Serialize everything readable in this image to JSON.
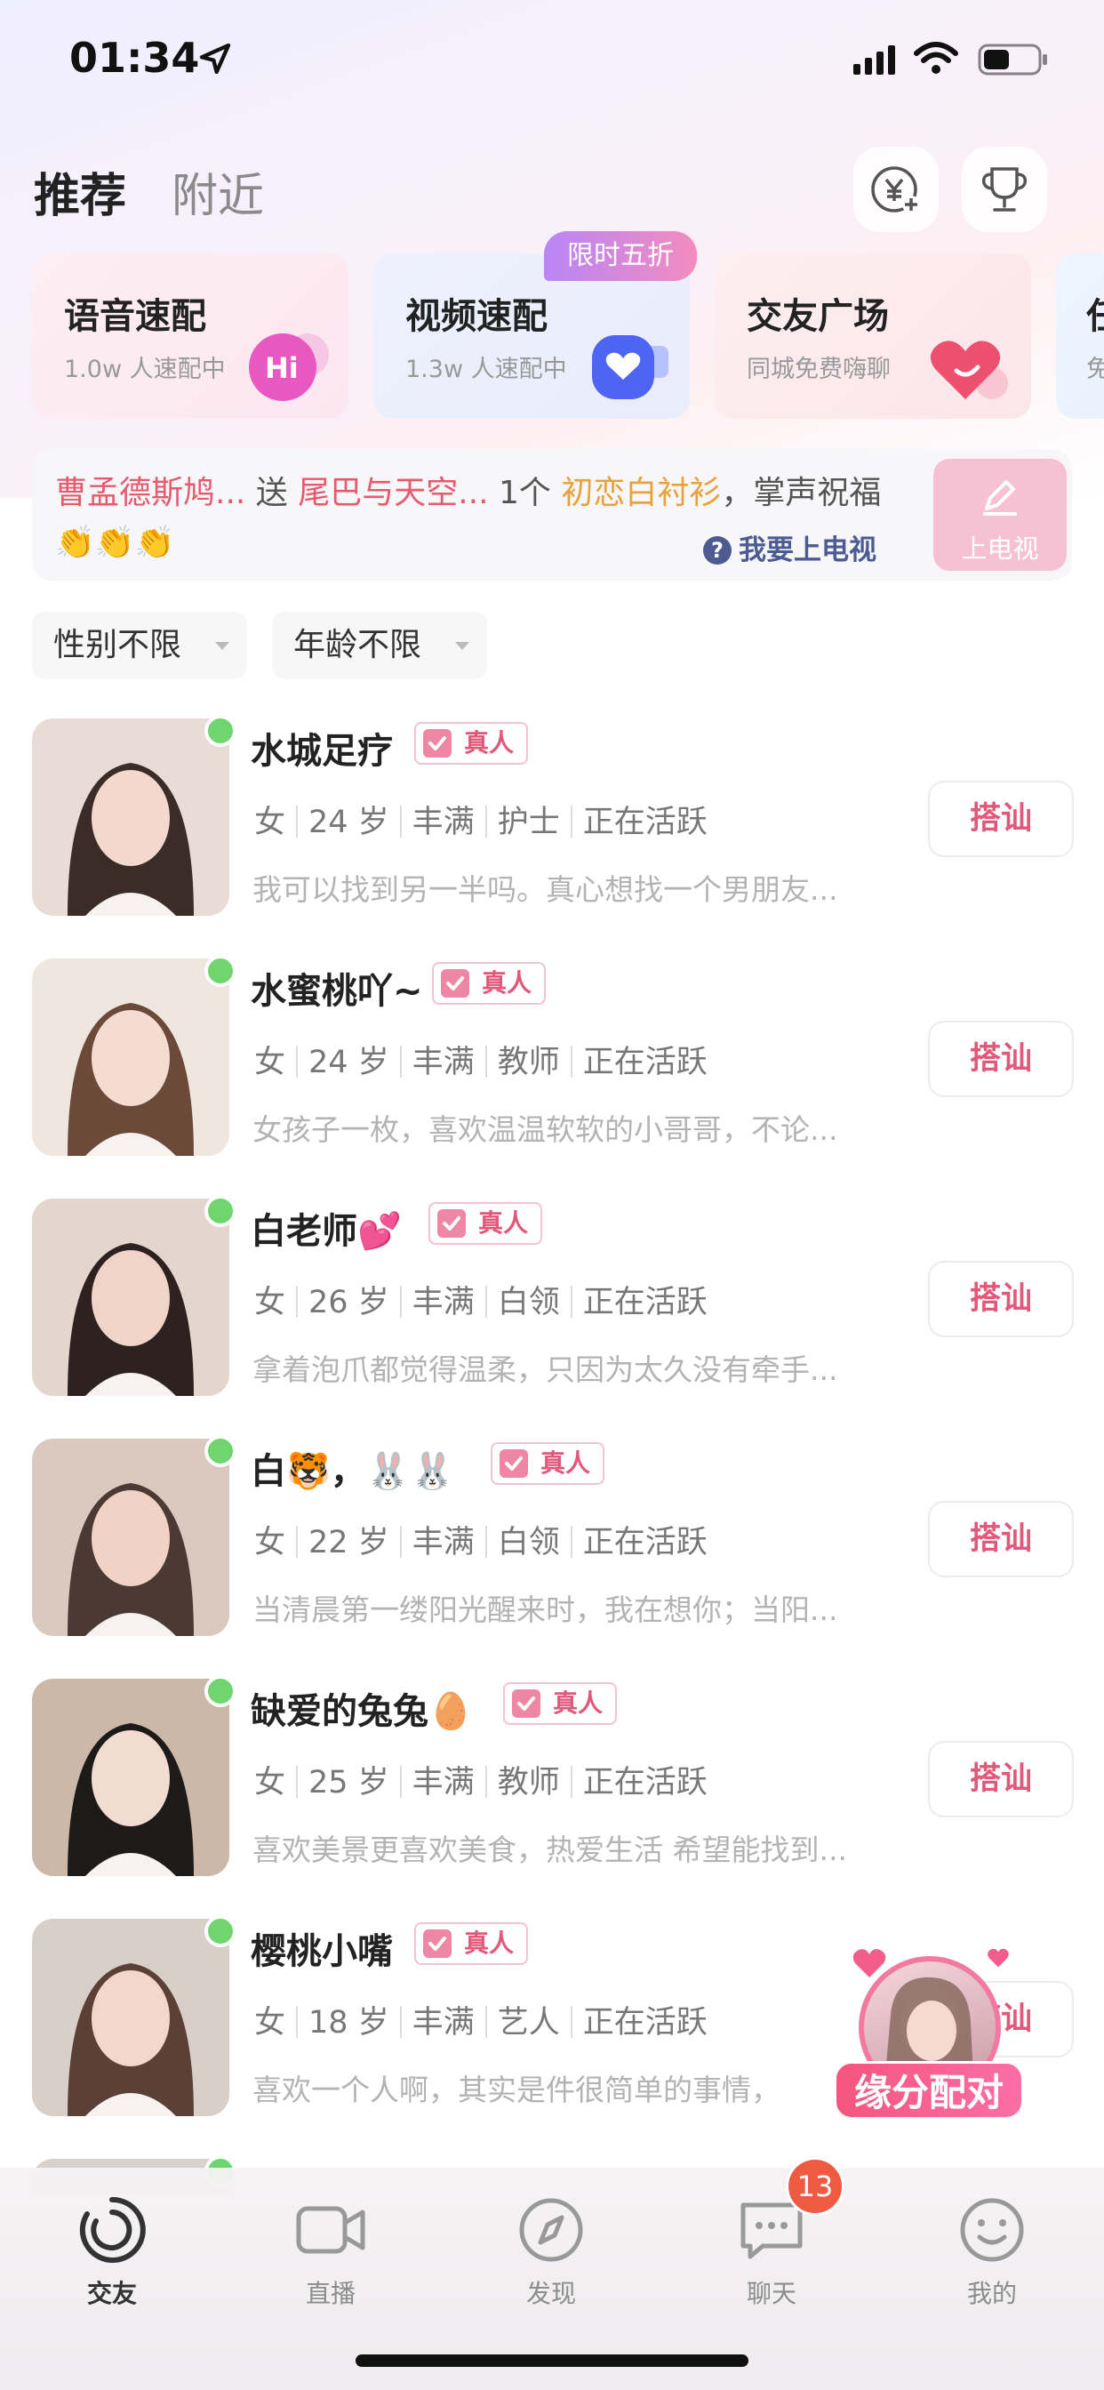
{
  "status_bar": {
    "time": "01:34"
  },
  "header": {
    "tab_recommend": "推荐",
    "tab_nearby": "附近"
  },
  "quick_cards": [
    {
      "title": "语音速配",
      "subtitle": "1.0w 人速配中",
      "icon": "hi-bubble-icon"
    },
    {
      "title": "视频速配",
      "subtitle": "1.3w 人速配中",
      "icon": "heart-camera-icon"
    },
    {
      "title": "交友广场",
      "subtitle": "同城免费嗨聊",
      "icon": "heart-icon"
    },
    {
      "title": "任",
      "subtitle": "免"
    }
  ],
  "promo_tag": "限时五折",
  "banner": {
    "sender": "曹孟德斯鸠...",
    "verb": " 送 ",
    "receiver": "尾巴与天空...",
    "quantity": " 1个 ",
    "gift": "初恋白衬衫",
    "tail": "，掌声祝福👏👏👏",
    "tv_link": "我要上电视",
    "tv_button": "上电视"
  },
  "filters": {
    "gender": "性别不限",
    "age": "年龄不限"
  },
  "verified_label": "真人",
  "greet_label": "搭讪",
  "users": [
    {
      "name": "水城足疗",
      "gender": "女",
      "age": "24 岁",
      "body": "丰满",
      "job": "护士",
      "status": "正在活跃",
      "bio": "我可以找到另一半吗。真心想找一个男朋友..."
    },
    {
      "name": "水蜜桃吖~",
      "gender": "女",
      "age": "24 岁",
      "body": "丰满",
      "job": "教师",
      "status": "正在活跃",
      "bio": "女孩子一枚，喜欢温温软软的小哥哥，不论..."
    },
    {
      "name": "白老师💕",
      "gender": "女",
      "age": "26 岁",
      "body": "丰满",
      "job": "白领",
      "status": "正在活跃",
      "bio": "拿着泡爪都觉得温柔，只因为太久没有牵手..."
    },
    {
      "name": "白🐯，🐰🐰",
      "gender": "女",
      "age": "22 岁",
      "body": "丰满",
      "job": "白领",
      "status": "正在活跃",
      "bio": "当清晨第一缕阳光醒来时，我在想你；当阳..."
    },
    {
      "name": "缺爱的兔兔🥚",
      "gender": "女",
      "age": "25 岁",
      "body": "丰满",
      "job": "教师",
      "status": "正在活跃",
      "bio": "喜欢美景更喜欢美食，热爱生活 希望能找到..."
    },
    {
      "name": "樱桃小嘴",
      "gender": "女",
      "age": "18 岁",
      "body": "丰满",
      "job": "艺人",
      "status": "正在活跃",
      "bio": "喜欢一个人啊，其实是件很简单的事情，"
    }
  ],
  "fate_match": "缘分配对",
  "nav": [
    {
      "label": "交友",
      "icon": "friends-icon"
    },
    {
      "label": "直播",
      "icon": "video-icon"
    },
    {
      "label": "发现",
      "icon": "compass-icon"
    },
    {
      "label": "聊天",
      "icon": "chat-icon",
      "badge": "13"
    },
    {
      "label": "我的",
      "icon": "smile-icon"
    }
  ],
  "colors": {
    "accent_pink": "#e2587b",
    "online_green": "#6fd56f",
    "badge_red": "#f05a40"
  }
}
